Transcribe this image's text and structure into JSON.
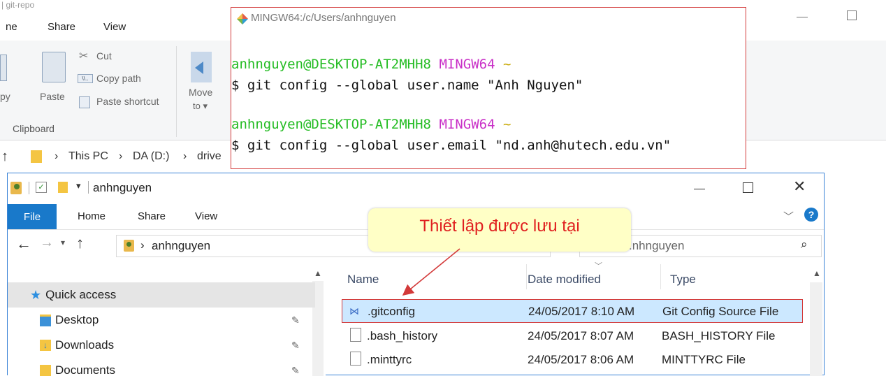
{
  "background_window": {
    "title_fragment": "| git-repo",
    "tabs": [
      "ne",
      "Share",
      "View"
    ],
    "ribbon": {
      "cut": "Cut",
      "copy_path": "Copy path",
      "paste_shortcut": "Paste shortcut",
      "copy": "py",
      "paste": "Paste",
      "move_to": "Move",
      "move_to_sub": "to",
      "group_clipboard": "Clipboard"
    },
    "address": {
      "this_pc": "This PC",
      "drive": "DA (D:)",
      "folder": "drive"
    }
  },
  "terminal": {
    "title": "MINGW64:/c/Users/anhnguyen",
    "lines": [
      {
        "user": "anhnguyen@DESKTOP-AT2MHH8",
        "env": "MINGW64",
        "path": "~"
      },
      {
        "cmd": "$ git config --global user.name \"Anh Nguyen\""
      },
      {
        "user": "anhnguyen@DESKTOP-AT2MHH8",
        "env": "MINGW64",
        "path": "~"
      },
      {
        "cmd": "$ git config --global user.email \"nd.anh@hutech.edu.vn\""
      }
    ]
  },
  "explorer": {
    "title": "anhnguyen",
    "tabs": {
      "file": "File",
      "home": "Home",
      "share": "Share",
      "view": "View"
    },
    "address_crumb": "anhnguyen",
    "search_text": ".nhnguyen",
    "nav": [
      {
        "label": "Quick access"
      },
      {
        "label": "Desktop"
      },
      {
        "label": "Downloads"
      },
      {
        "label": "Documents"
      }
    ],
    "columns": {
      "name": "Name",
      "date": "Date modified",
      "type": "Type"
    },
    "files": [
      {
        "name": ".gitconfig",
        "date": "24/05/2017 8:10 AM",
        "type": "Git Config Source File"
      },
      {
        "name": ".bash_history",
        "date": "24/05/2017 8:07 AM",
        "type": "BASH_HISTORY File"
      },
      {
        "name": ".minttyrc",
        "date": "24/05/2017 8:06 AM",
        "type": "MINTTYRC File"
      }
    ]
  },
  "callout": {
    "text": "Thiết lập được lưu tại"
  },
  "colors": {
    "accent": "#1979ca",
    "highlight_border": "#d33a3a",
    "callout_bg": "#ffffc6",
    "callout_text": "#e02020"
  }
}
